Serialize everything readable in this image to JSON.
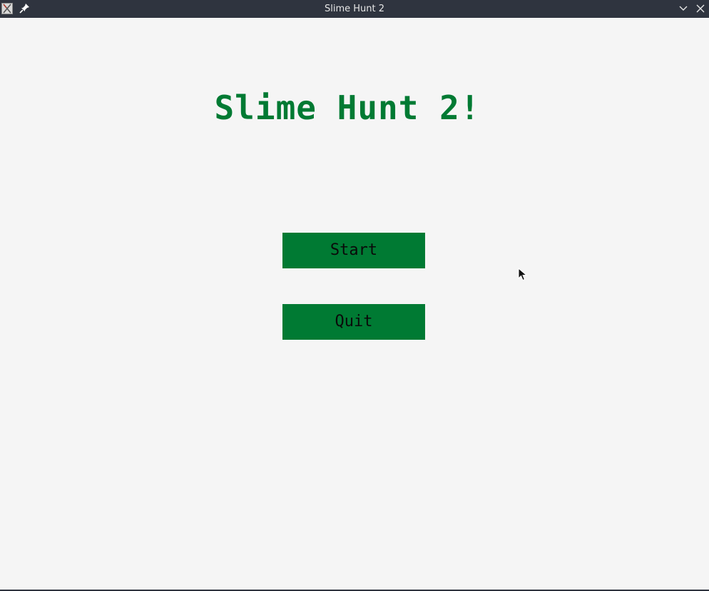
{
  "window": {
    "title": "Slime Hunt 2"
  },
  "game": {
    "title": "Slime Hunt 2!",
    "buttons": {
      "start_label": "Start",
      "quit_label": "Quit"
    }
  },
  "colors": {
    "accent": "#007a33",
    "background": "#f5f5f5",
    "titlebar": "#2f343f"
  },
  "icons": {
    "app": "app-icon",
    "pin": "pin-icon",
    "minimize": "chevron-down-icon",
    "close": "close-icon",
    "cursor": "mouse-cursor-icon"
  }
}
